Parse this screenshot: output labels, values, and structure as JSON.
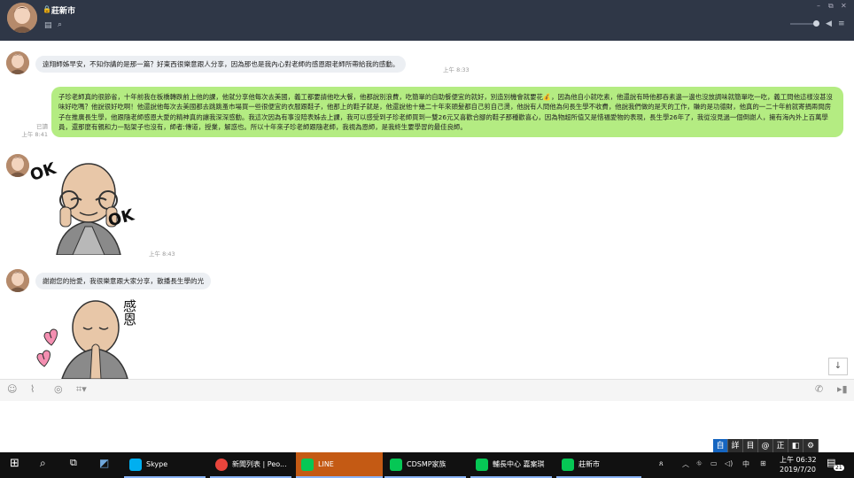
{
  "header": {
    "title": "莊新市",
    "lock_icon": "lock-icon",
    "window": {
      "minimize": "–",
      "maximize": "⧉",
      "close": "✕"
    }
  },
  "messages": {
    "m1": {
      "text": "遠翔師姊早安，不知你講的是那一篇？好東西很樂意跟人分享，因為那也是我內心對老師的感恩跟老師所帶給我的感動。",
      "time": "上午 8:33"
    },
    "m2": {
      "read": "已讀",
      "time": "上午 8:41",
      "text": "子珍老師真的很節省，十年前我在板橋轉跌前上他的課，他就分享他每次去美國，義工都要請他吃大餐，他都說別浪費，吃簡單的自助餐便宜的就好，別造別機會就要花💰，因為他自小就吃素，他還說有時他都吞素邊一邊也沒放調味就簡單吃一吃，義工問他這樣沒甚沒味好吃嗎？他說很好吃啊！他還說他每次去美國都去跳跳蚤市場買一些很便宜的衣服跟鞋子，他那上的鞋子就是，他還說他十幾二十年來頭髮都自己剪自己燙，他說有人問他為何長生學不收費，他說我們做的是天的工作，賺的是功德財，他真的一二十年前就寄捐兩間房子在推廣長生學，他跟隨老師感恩大愛的精神真的讓我深深感動。我這次因為有事沒陪表姊去上課，我可以感受到子珍老師買到一雙26元又喜歡合腳的鞋子那種歡喜心，因為物超所值又是惜福愛物的表現，長生學26年了，我從沒見過一個倒謝人，擁有海內外上百萬學員，還那麼有親和力一點架子也沒有，師者:傳道，授業，解惑也。所以十年來子珍老師跟隨老師，我視為恩師，是我終生要學習的最佳良師。"
    },
    "m3": {
      "sticker_text_1": "OK",
      "sticker_text_2": "OK",
      "time": "上午 8:43"
    },
    "m4": {
      "text": "謝謝您的抬愛，我很樂意跟大家分享，散播長生學的光"
    },
    "m5": {
      "sticker_text": "感恩"
    }
  },
  "ime": [
    "自",
    "詳",
    "目",
    "@",
    "正",
    "◧",
    "⚙"
  ],
  "taskbar": {
    "tasks": [
      {
        "label": "Skype",
        "icon": "skype-icon",
        "color": "#00aff0"
      },
      {
        "label": "新聞列表 | Peo...",
        "icon": "chrome-icon",
        "color": "#e8453c"
      },
      {
        "label": "LINE",
        "icon": "line-icon",
        "color": "#06c755"
      },
      {
        "label": "CDSMP家族",
        "icon": "line-group-icon",
        "color": "#06c755"
      },
      {
        "label": "輔長中心 嘉案琪",
        "icon": "line-user-icon",
        "color": "#06c755"
      },
      {
        "label": "莊新市",
        "icon": "line-user-icon",
        "color": "#06c755"
      }
    ],
    "system": {
      "ime_mode": "中",
      "clock_time": "上午 06:32",
      "clock_date": "2019/7/20",
      "notifications": "21"
    }
  }
}
